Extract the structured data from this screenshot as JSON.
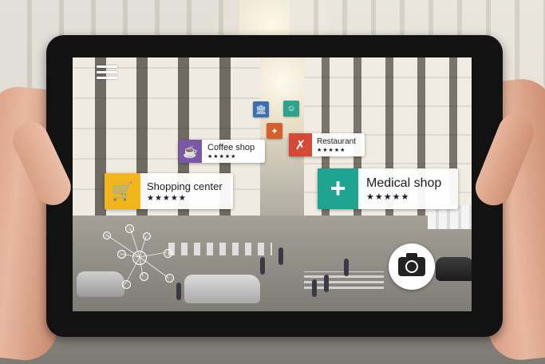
{
  "menu": {
    "icon": "hamburger-menu-icon"
  },
  "poi_cards": [
    {
      "label": "Coffee shop",
      "stars": "★★★★★",
      "icon": "coffee-cup-icon",
      "color": "#7b57a6"
    },
    {
      "label": "Restaurant",
      "stars": "★★★★★",
      "icon": "fork-knife-icon",
      "color": "#d44a37"
    },
    {
      "label": "Shopping center",
      "stars": "★★★★★",
      "icon": "shopping-cart-icon",
      "color": "#f3b51c"
    },
    {
      "label": "Medical shop",
      "stars": "★★★★★",
      "icon": "medical-cross-icon",
      "color": "#1fa492"
    }
  ],
  "small_pois": [
    {
      "icon": "museum-icon",
      "color": "#3a6fb0"
    },
    {
      "icon": "theatre-masks-icon",
      "color": "#2ea38c"
    },
    {
      "icon": "cocktail-icon",
      "color": "#d2612f"
    }
  ],
  "camera": {
    "icon": "camera-icon"
  }
}
